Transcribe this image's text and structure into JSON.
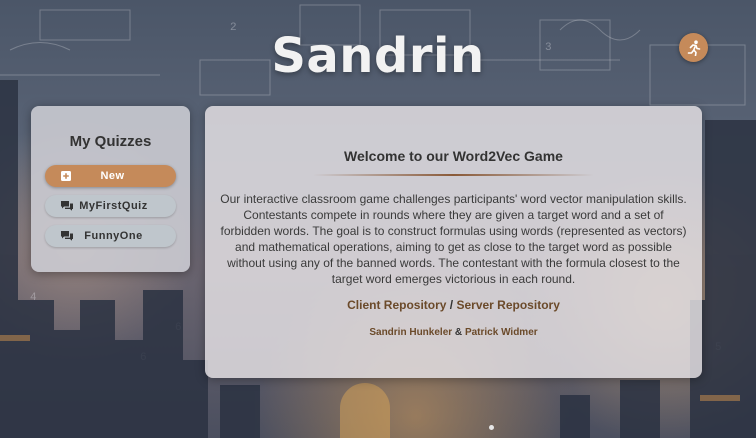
{
  "app": {
    "title": "Sandrin"
  },
  "sidebar": {
    "heading": "My Quizzes",
    "new_label": "New",
    "quizzes": [
      {
        "label": "MyFirstQuiz"
      },
      {
        "label": "FunnyOne"
      }
    ]
  },
  "welcome": {
    "heading": "Welcome to our Word2Vec Game",
    "description": "Our interactive classroom game challenges participants' word vector manipulation skills. Contestants compete in rounds where they are given a target word and a set of forbidden words. The goal is to construct formulas using words (represented as vectors) and mathematical operations, aiming to get as close to the target word as possible without using any of the banned words. The contestant with the formula closest to the target word emerges victorious in each round.",
    "client_repo": "Client Repository",
    "repo_separator": " / ",
    "server_repo": "Server Repository",
    "author_1": "Sandrin Hunkeler",
    "author_separator": " & ",
    "author_2": "Patrick Widmer"
  },
  "icons": {
    "top_right": "running-person-icon",
    "new": "plus-square-icon",
    "quiz": "chat-bubbles-icon"
  },
  "colors": {
    "accent": "#c58a5a",
    "link": "#6b4a2a"
  }
}
